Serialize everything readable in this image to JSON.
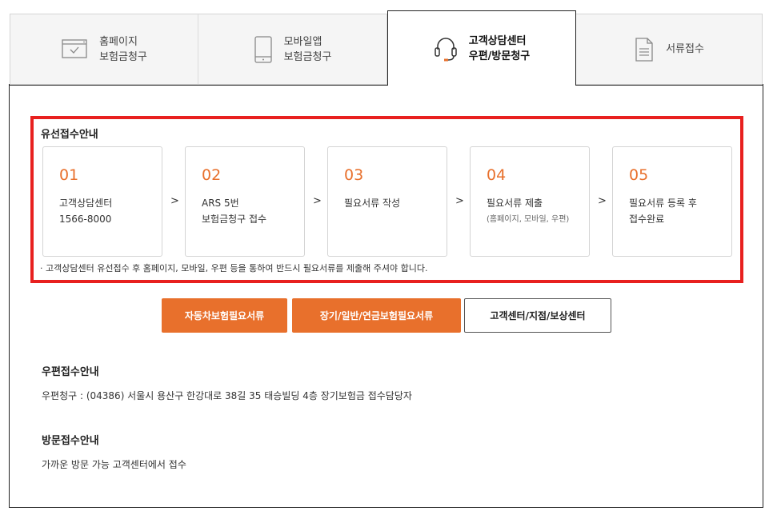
{
  "tabs": [
    {
      "line1": "홈페이지",
      "line2": "보험금청구",
      "icon": "monitor-check-icon"
    },
    {
      "line1": "모바일앱",
      "line2": "보험금청구",
      "icon": "mobile-phone-icon"
    },
    {
      "line1": "고객상담센터",
      "line2": "우편/방문청구",
      "icon": "headset-icon",
      "active": true
    },
    {
      "line1": "서류접수",
      "line2": "",
      "icon": "document-icon"
    }
  ],
  "wired": {
    "title": "유선접수안내",
    "steps": [
      {
        "num": "01",
        "line1": "고객상담센터",
        "line2": "1566-8000",
        "sub": ""
      },
      {
        "num": "02",
        "line1": "ARS 5번",
        "line2": "보험금청구 접수",
        "sub": ""
      },
      {
        "num": "03",
        "line1": "필요서류 작성",
        "line2": "",
        "sub": ""
      },
      {
        "num": "04",
        "line1": "필요서류 제출",
        "line2": "",
        "sub": "(홈페이지, 모바일, 우편)"
      },
      {
        "num": "05",
        "line1": "필요서류 등록 후",
        "line2": "접수완료",
        "sub": ""
      }
    ],
    "arrow": ">",
    "note": "· 고객상담센터 유선접수 후 홈페이지, 모바일, 우편 등을 통하여 반드시 필요서류를 제출해 주셔야 합니다."
  },
  "buttons": {
    "auto": "자동차보험필요서류",
    "longterm": "장기/일반/연금보험필요서류",
    "center": "고객센터/지점/보상센터"
  },
  "mail": {
    "title": "우편접수안내",
    "text": "우편청구 : (04386) 서울시 용산구 한강대로 38길 35 태승빌딩 4층 장기보험금 접수담당자"
  },
  "visit": {
    "title": "방문접수안내",
    "text": "가까운 방문 가능 고객센터에서 접수"
  },
  "colors": {
    "accent": "#e8702c",
    "highlight": "#e8201f"
  }
}
